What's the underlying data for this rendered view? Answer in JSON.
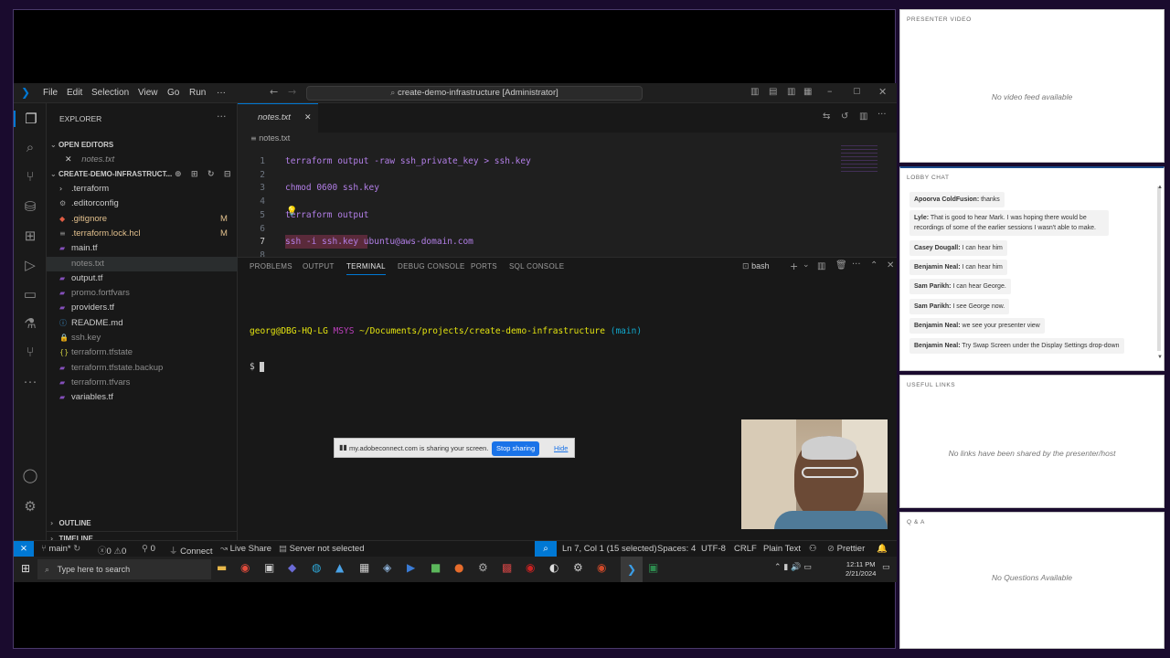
{
  "vscode": {
    "menu": [
      "File",
      "Edit",
      "Selection",
      "View",
      "Go",
      "Run",
      "···"
    ],
    "command_center": "create-demo-infrastructure [Administrator]",
    "explorer": {
      "title": "EXPLORER",
      "open_editors_label": "OPEN EDITORS",
      "open_file": "notes.txt",
      "project_label": "CREATE-DEMO-INFRASTRUCT...",
      "files": [
        {
          "name": ".terraform",
          "badge": "",
          "color": "#cccccc",
          "icon": "chevron-right-icon"
        },
        {
          "name": ".editorconfig",
          "badge": "",
          "color": "#cccccc",
          "icon": "gear-icon"
        },
        {
          "name": ".gitignore",
          "badge": "M",
          "color": "#e2c08d",
          "icon": "git-icon"
        },
        {
          "name": ".terraform.lock.hcl",
          "badge": "M",
          "color": "#e2c08d",
          "icon": "file-icon"
        },
        {
          "name": "main.tf",
          "badge": "",
          "color": "#cccccc",
          "icon": "terraform-icon"
        },
        {
          "name": "notes.txt",
          "badge": "",
          "color": "#8c8c8c",
          "icon": "none"
        },
        {
          "name": "output.tf",
          "badge": "",
          "color": "#cccccc",
          "icon": "terraform-icon"
        },
        {
          "name": "promo.fortfvars",
          "badge": "",
          "color": "#8c8c8c",
          "icon": "terraform-icon"
        },
        {
          "name": "providers.tf",
          "badge": "",
          "color": "#cccccc",
          "icon": "terraform-icon"
        },
        {
          "name": "README.md",
          "badge": "",
          "color": "#cccccc",
          "icon": "info-icon"
        },
        {
          "name": "ssh.key",
          "badge": "",
          "color": "#8c8c8c",
          "icon": "key-icon"
        },
        {
          "name": "terraform.tfstate",
          "badge": "",
          "color": "#8c8c8c",
          "icon": "braces-icon"
        },
        {
          "name": "terraform.tfstate.backup",
          "badge": "",
          "color": "#8c8c8c",
          "icon": "terraform-icon"
        },
        {
          "name": "terraform.tfvars",
          "badge": "",
          "color": "#8c8c8c",
          "icon": "terraform-icon"
        },
        {
          "name": "variables.tf",
          "badge": "",
          "color": "#cccccc",
          "icon": "terraform-icon"
        }
      ],
      "outline_label": "OUTLINE",
      "timeline_label": "TIMELINE"
    },
    "tab": "notes.txt",
    "breadcrumb": "notes.txt",
    "code_lines": [
      {
        "n": "1",
        "text": "terraform output -raw ssh_private_key > ssh.key"
      },
      {
        "n": "2",
        "text": ""
      },
      {
        "n": "3",
        "text": "chmod 0600 ssh.key"
      },
      {
        "n": "4",
        "text": ""
      },
      {
        "n": "5",
        "text": "terraform output"
      },
      {
        "n": "6",
        "text": ""
      },
      {
        "n": "7",
        "text": "ssh -i ssh.key ubuntu@aws-domain.com"
      },
      {
        "n": "8",
        "text": ""
      }
    ],
    "panel_tabs": [
      "PROBLEMS",
      "OUTPUT",
      "TERMINAL",
      "DEBUG CONSOLE",
      "PORTS",
      "SQL CONSOLE"
    ],
    "terminal": {
      "shell": "bash",
      "prompt_user": "georg@DBG-HQ-LG",
      "prompt_env": "MSYS",
      "prompt_path": "~/Documents/projects/create-demo-infrastructure",
      "prompt_branch": "(main)",
      "prompt_symbol": "$"
    },
    "status": {
      "branch": "main*",
      "errors": "0",
      "warnings": "0",
      "ports": "0",
      "connect": "Connect",
      "live_share": "Live Share",
      "server": "Server not selected",
      "position": "Ln 7, Col 1 (15 selected)",
      "spaces": "Spaces: 4",
      "encoding": "UTF-8",
      "eol": "CRLF",
      "language": "Plain Text",
      "prettier": "Prettier"
    },
    "share_notice": {
      "text": "my.adobeconnect.com is sharing your screen.",
      "stop": "Stop sharing",
      "hide": "Hide"
    },
    "taskbar": {
      "search": "Type here to search",
      "time": "12:11 PM",
      "date": "2/21/2024"
    }
  },
  "panels": {
    "presenter_video": {
      "title": "PRESENTER VIDEO",
      "empty": "No video feed available"
    },
    "lobby_chat": {
      "title": "LOBBY CHAT",
      "messages": [
        {
          "author": "Apoorva ColdFusion:",
          "text": " thanks"
        },
        {
          "author": "Lyle:",
          "text": " That is good to hear Mark. I was hoping there would be recordings of some of the earlier sessions I wasn't able to make."
        },
        {
          "author": "Casey Dougall:",
          "text": " I can hear him"
        },
        {
          "author": "Benjamin Neal:",
          "text": " I can hear him"
        },
        {
          "author": "Sam Parikh:",
          "text": " I can hear George."
        },
        {
          "author": "Sam Parikh:",
          "text": " I see George now."
        },
        {
          "author": "Benjamin Neal:",
          "text": " we see your presenter view"
        },
        {
          "author": "Benjamin Neal:",
          "text": " Try Swap Screen under the Display Settings drop-down"
        }
      ]
    },
    "useful_links": {
      "title": "USEFUL LINKS",
      "empty": "No links have been shared by the presenter/host"
    },
    "qa": {
      "title": "Q & A",
      "empty": "No Questions Available"
    }
  },
  "colors": {
    "accent": "#0078d4",
    "keyword": "#b37fe8",
    "string": "#ce9178",
    "status_blue": "#0078d4"
  }
}
